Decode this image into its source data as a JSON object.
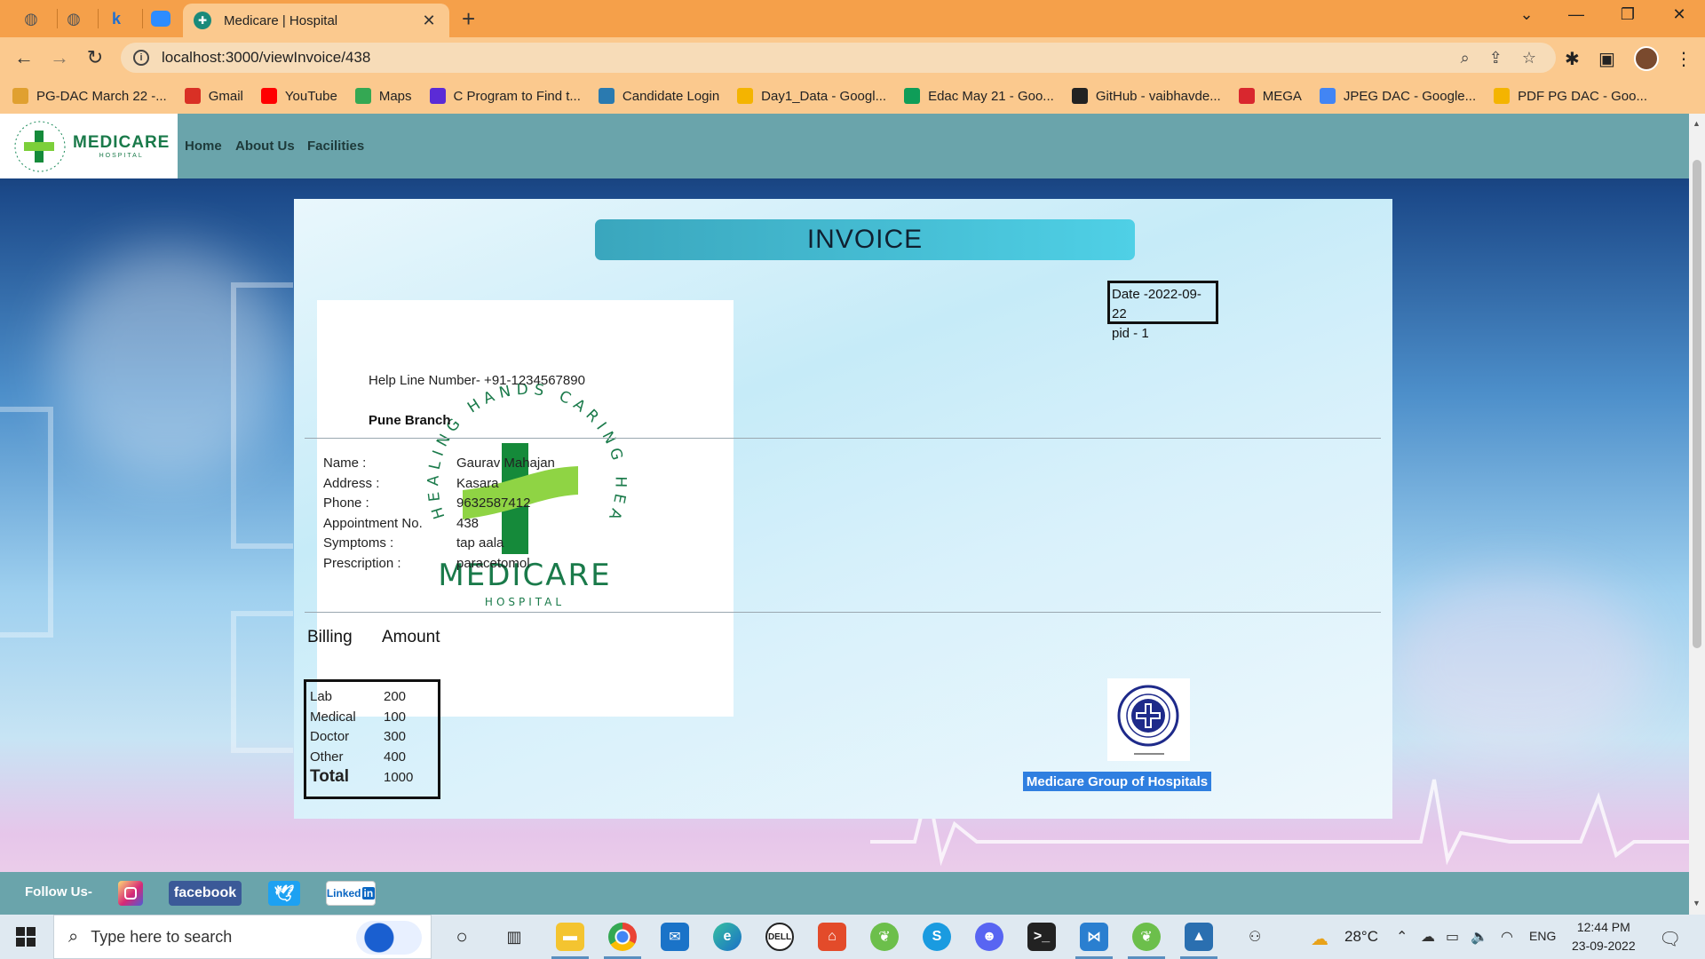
{
  "browser": {
    "active_tab_title": "Medicare | Hospital",
    "url": "localhost:3000/viewInvoice/438",
    "bookmarks": [
      {
        "label": "PG-DAC March 22 -...",
        "color": "#e0a030"
      },
      {
        "label": "Gmail",
        "color": "#d93025"
      },
      {
        "label": "YouTube",
        "color": "#ff0000"
      },
      {
        "label": "Maps",
        "color": "#34a853"
      },
      {
        "label": "C Program to Find t...",
        "color": "#5b2bd6"
      },
      {
        "label": "Candidate Login",
        "color": "#2a7ab0"
      },
      {
        "label": "Day1_Data - Googl...",
        "color": "#f4b400"
      },
      {
        "label": "Edac May 21 - Goo...",
        "color": "#0f9d58"
      },
      {
        "label": "GitHub - vaibhavde...",
        "color": "#222222"
      },
      {
        "label": "MEGA",
        "color": "#d9272e"
      },
      {
        "label": "JPEG DAC - Google...",
        "color": "#4285f4"
      },
      {
        "label": "PDF PG DAC - Goo...",
        "color": "#f4b400"
      }
    ]
  },
  "site": {
    "logo_text": "MEDICARE",
    "logo_sub": "HOSPITAL",
    "nav": [
      "Home",
      "About Us",
      "Facilities"
    ]
  },
  "invoice": {
    "heading": "INVOICE",
    "date_line": "Date -2022-09-22",
    "pid_line": "pid -  1",
    "helpline": "Help Line Number- +91-1234567890",
    "branch": "Pune Branch",
    "watermark_ring": "HEALING HANDS CARING HEARTS",
    "watermark_name": "MEDICARE",
    "watermark_sub": "HOSPITAL",
    "patient": [
      {
        "label": "Name :",
        "value": "Gaurav Mahajan"
      },
      {
        "label": "Address :",
        "value": "Kasara"
      },
      {
        "label": "Phone :",
        "value": "9632587412"
      },
      {
        "label": "Appointment No.",
        "value": "438"
      },
      {
        "label": "Symptoms :",
        "value": "tap aala"
      },
      {
        "label": "Prescription :",
        "value": "paracetomol"
      }
    ],
    "billing_header": "Billing",
    "amount_header": "Amount",
    "bill": [
      {
        "item": "Lab",
        "amount": "200"
      },
      {
        "item": "Medical",
        "amount": "100"
      },
      {
        "item": "Doctor",
        "amount": "300"
      },
      {
        "item": "Other",
        "amount": "400"
      }
    ],
    "total_label": "Total",
    "total_amount": "1000",
    "group_name": "Medicare Group of Hospitals"
  },
  "footer": {
    "follow": "Follow Us-",
    "social": [
      "facebook",
      "Linked"
    ]
  },
  "taskbar": {
    "search_placeholder": "Type here to search",
    "temperature": "28°C",
    "language": "ENG",
    "time": "12:44 PM",
    "date": "23-09-2022"
  }
}
